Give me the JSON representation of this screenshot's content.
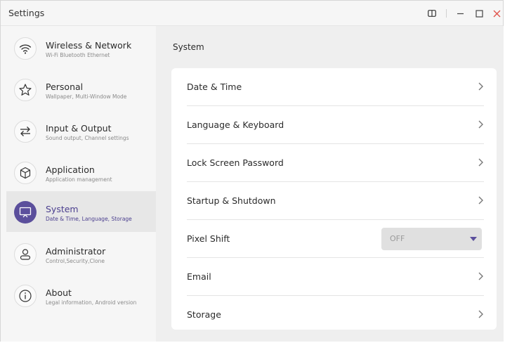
{
  "window": {
    "title": "Settings"
  },
  "sidebar": {
    "items": [
      {
        "title": "Wireless & Network",
        "subtitle": "Wi-Fi Bluetooth Ethernet",
        "icon": "wifi-icon"
      },
      {
        "title": "Personal",
        "subtitle": "Wallpaper, Multi-Window Mode",
        "icon": "star-icon"
      },
      {
        "title": "Input & Output",
        "subtitle": "Sound output, Channel settings",
        "icon": "swap-arrows-icon"
      },
      {
        "title": "Application",
        "subtitle": "Application management",
        "icon": "cube-icon"
      },
      {
        "title": "System",
        "subtitle": "Date & Time, Language, Storage",
        "icon": "monitor-icon",
        "active": true
      },
      {
        "title": "Administrator",
        "subtitle": "Control,Security,Clone",
        "icon": "person-icon"
      },
      {
        "title": "About",
        "subtitle": "Legal information, Android version",
        "icon": "info-icon"
      }
    ]
  },
  "main": {
    "section_title": "System",
    "rows": [
      {
        "label": "Date & Time"
      },
      {
        "label": "Language & Keyboard"
      },
      {
        "label": "Lock Screen Password"
      },
      {
        "label": "Startup & Shutdown"
      },
      {
        "label": "Pixel Shift",
        "dropdown_value": "OFF"
      },
      {
        "label": "Email"
      },
      {
        "label": "Storage"
      }
    ]
  },
  "colors": {
    "accent": "#5b4f9c",
    "sidebar_bg": "#f6f6f6",
    "active_item_bg": "#e7e7e7",
    "close": "#e0524a"
  }
}
